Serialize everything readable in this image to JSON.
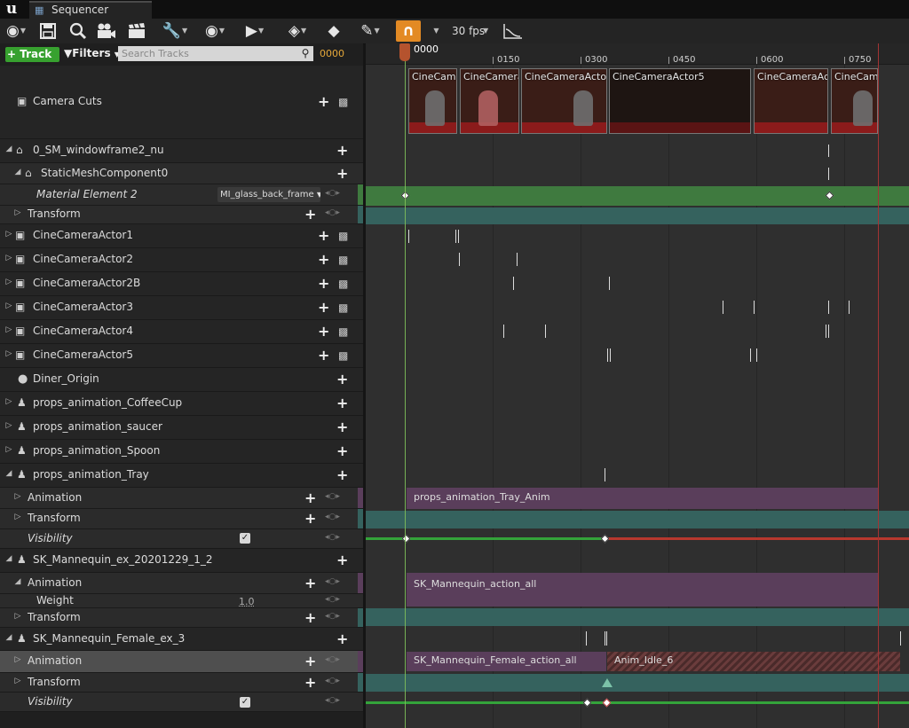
{
  "window": {
    "tab_title": "Sequencer"
  },
  "toolbar": {
    "fps_label": "30 fps",
    "tools": [
      "world-icon",
      "save-icon",
      "search-icon",
      "camera-icon",
      "clapper-icon",
      "wrench-icon",
      "eye-icon",
      "play-icon",
      "key-icon",
      "tag-icon",
      "pencil-icon",
      "magnet-icon",
      "curve-icon"
    ]
  },
  "filterbar": {
    "add_track_label": "Track",
    "filters_label": "Filters",
    "search_placeholder": "Search Tracks",
    "current_frame": "0000"
  },
  "tree": {
    "camera_cuts": "Camera Cuts",
    "windowframe": "0_SM_windowframe2_nu",
    "static_mesh": "StaticMeshComponent0",
    "material_element": "Material Element 2",
    "material_value": "MI_glass_back_frame",
    "transform": "Transform",
    "cam1": "CineCameraActor1",
    "cam2": "CineCameraActor2",
    "cam2b": "CineCameraActor2B",
    "cam3": "CineCameraActor3",
    "cam4": "CineCameraActor4",
    "cam5": "CineCameraActor5",
    "diner": "Diner_Origin",
    "coffee": "props_animation_CoffeeCup",
    "saucer": "props_animation_saucer",
    "spoon": "props_animation_Spoon",
    "tray": "props_animation_Tray",
    "animation": "Animation",
    "visibility": "Visibility",
    "mannequin": "SK_Mannequin_ex_20201229_1_2",
    "weight": "Weight",
    "weight_value": "1.0",
    "mannequin_female": "SK_Mannequin_Female_ex_3"
  },
  "timeline": {
    "playhead_label": "0000",
    "ticks": [
      "0150",
      "0300",
      "0450",
      "0600",
      "0750"
    ],
    "shots": [
      "CineCame",
      "CineCamera",
      "CineCameraActor",
      "CineCameraActor5",
      "CineCameraAct",
      "CineCam"
    ],
    "sections": {
      "tray_anim": "props_animation_Tray_Anim",
      "mannequin_anim": "SK_Mannequin_action_all",
      "female_anim": "SK_Mannequin_Female_action_all",
      "idle_anim": "Anim_Idle_6"
    }
  },
  "colors": {
    "accent_orange": "#e38a24",
    "add_green": "#37a12f",
    "material_green": "#3f7a3f",
    "transform_teal": "#35625e",
    "anim_purple": "#5a3e5b",
    "end_red": "#a33434"
  }
}
